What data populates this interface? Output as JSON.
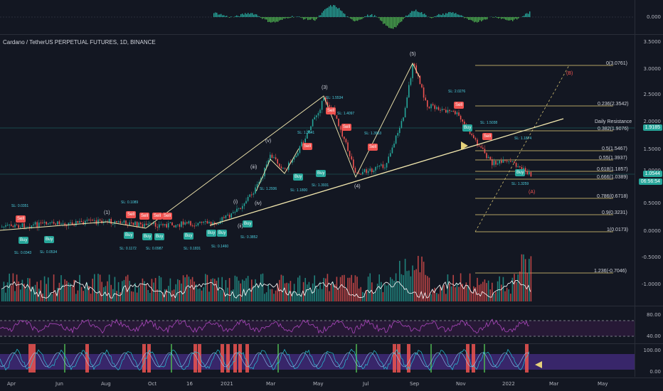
{
  "symbol_title": "Cardano / TetherUS PERPETUAL FUTURES, 1D, BINANCE",
  "top_axis": [
    "0.000"
  ],
  "price_axis": [
    "3.5000",
    "3.0000",
    "2.5000",
    "2.0000",
    "1.5000",
    "1.0000",
    "0.5000",
    "0.0000",
    "-0.5000",
    "-1.0000"
  ],
  "current_price": "1.0544",
  "countdown": "06:56:54",
  "marker_price": "1.9185",
  "rsi_axis": [
    "80.00",
    "40.00"
  ],
  "osc_axis": [
    "100.00",
    "0.00"
  ],
  "x_axis": [
    "Apr",
    "Jun",
    "Aug",
    "Oct",
    "16",
    "2021",
    "Mar",
    "May",
    "Jul",
    "Sep",
    "Nov",
    "2022",
    "Mar",
    "May"
  ],
  "fib_levels": [
    "0(3.0761)",
    "0.236(2.3542)",
    "Daily Resistance",
    "0.382(1.9076)",
    "0.5(1.5467)",
    "0.55(1.3937)",
    "0.618(1.1857)",
    "0.666(1.0389)",
    "0.786(0.6718)",
    "0.9(0.3231)",
    "1(0.0173)",
    "1.236(-0.7046)"
  ],
  "waves": [
    "(5)",
    "(3)",
    "(4)",
    "(v)",
    "(iii)",
    "(i)",
    "(iv)",
    "(ii)",
    "(1)",
    "(B)",
    "(A)"
  ],
  "signals": {
    "buy": [
      "Buy",
      "Buy",
      "Buy",
      "Buy",
      "Buy",
      "Buy",
      "Buy",
      "Buy",
      "Buy",
      "Buy",
      "Buy",
      "Buy",
      "Buy"
    ],
    "sell": [
      "Sell",
      "Sell",
      "Sell",
      "Sell",
      "Sell",
      "Sell",
      "Sell",
      "Sell",
      "Sell",
      "Sell",
      "Sell"
    ]
  },
  "stop_losses": [
    "SL: 0.0351",
    "SL: 0.0343",
    "SL: 0.0534",
    "SL: 0.1089",
    "SL: 0.1172",
    "SL: 0.0987",
    "SL: 0.1831",
    "SL: 0.1460",
    "SL: 0.3852",
    "SL: 1.2936",
    "SL: 1.1800",
    "SL: 1.3541",
    "SL: 1.3931",
    "SL: 1.5534",
    "SL: 1.4097",
    "SL: 1.3953",
    "SL: 2.0276",
    "SL: 1.5038",
    "SL: 1.1874",
    "SL: 1.3259"
  ],
  "colors": {
    "background": "#131722",
    "buy": "#26a69a",
    "sell": "#ef5350",
    "fib": "#e6d27a",
    "trend": "#f5eab0",
    "rsi": "#9c27b0"
  }
}
